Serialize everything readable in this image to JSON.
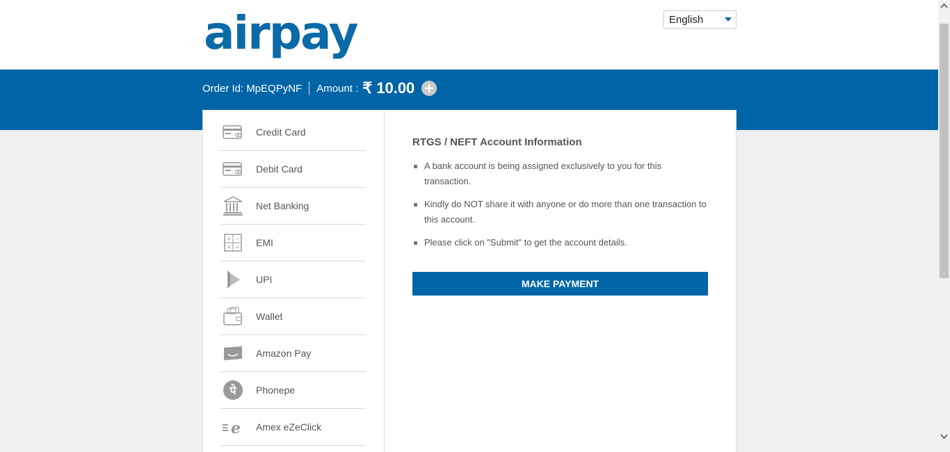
{
  "brand": {
    "logo": "airpay"
  },
  "language": {
    "selected": "English"
  },
  "order": {
    "order_id_label": "Order Id:",
    "order_id": "MpEQPyNF",
    "amount_label": "Amount :",
    "currency_symbol": "₹",
    "amount": "10.00"
  },
  "payment_methods": [
    {
      "label": "Credit Card",
      "icon": "credit-card-icon"
    },
    {
      "label": "Debit Card",
      "icon": "debit-card-icon"
    },
    {
      "label": "Net Banking",
      "icon": "bank-icon"
    },
    {
      "label": "EMI",
      "icon": "calculator-icon"
    },
    {
      "label": "UPI",
      "icon": "upi-icon"
    },
    {
      "label": "Wallet",
      "icon": "wallet-icon"
    },
    {
      "label": "Amazon Pay",
      "icon": "amazon-pay-icon"
    },
    {
      "label": "Phonepe",
      "icon": "phonepe-icon"
    },
    {
      "label": "Amex eZeClick",
      "icon": "amex-ezeclick-icon"
    }
  ],
  "info": {
    "title": "RTGS / NEFT Account Information",
    "bullets": [
      "A bank account is being assigned exclusively to you for this transaction.",
      "Kindly do NOT share it with anyone or do more than one transaction to this account.",
      "Please click on \"Submit\" to get the account details."
    ],
    "button_label": "MAKE PAYMENT"
  },
  "colors": {
    "brand_blue": "#0065a6",
    "logo_blue": "#0b6aa8"
  }
}
